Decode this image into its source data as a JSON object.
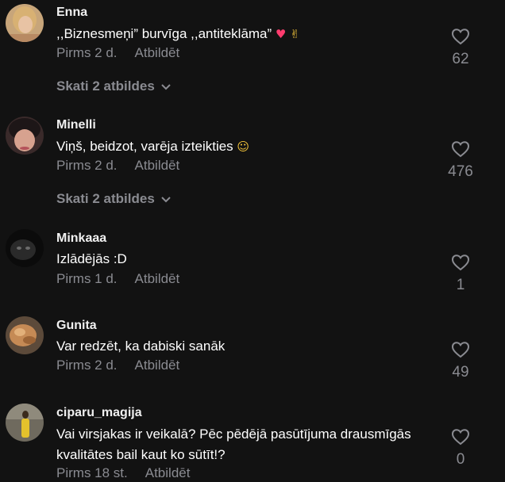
{
  "colors": {
    "background": "#121212",
    "muted": "#8a8b91",
    "text": "#ffffff"
  },
  "comments": [
    {
      "username": "Enna",
      "text": ",,Biznesmeņi” burvīga ,,antiteklāma”",
      "emojis": [
        "pink-heart",
        "ok-hand"
      ],
      "time": "Pirms 2 d.",
      "reply_label": "Atbildēt",
      "likes": "62",
      "view_replies": "Skati 2 atbildes"
    },
    {
      "username": "Minelli",
      "text": "Viņš, beidzot, varēja izteikties",
      "emojis": [
        "laughing-face"
      ],
      "time": "Pirms 2 d.",
      "reply_label": "Atbildēt",
      "likes": "476",
      "view_replies": "Skati 2 atbildes"
    },
    {
      "username": "Minkaaa",
      "text": "Izlādējās :D",
      "time": "Pirms 1 d.",
      "reply_label": "Atbildēt",
      "likes": "1"
    },
    {
      "username": "Gunita",
      "text": "Var redzēt, ka dabiski sanāk",
      "time": "Pirms 2 d.",
      "reply_label": "Atbildēt",
      "likes": "49"
    },
    {
      "username": "ciparu_magija",
      "text": "Vai virsjakas ir veikalā? Pēc pēdējā pasūtījuma drausmīgās kvalitātes bail kaut ko sūtīt!?",
      "time": "Pirms 18 st.",
      "reply_label": "Atbildēt",
      "likes": "0"
    }
  ]
}
